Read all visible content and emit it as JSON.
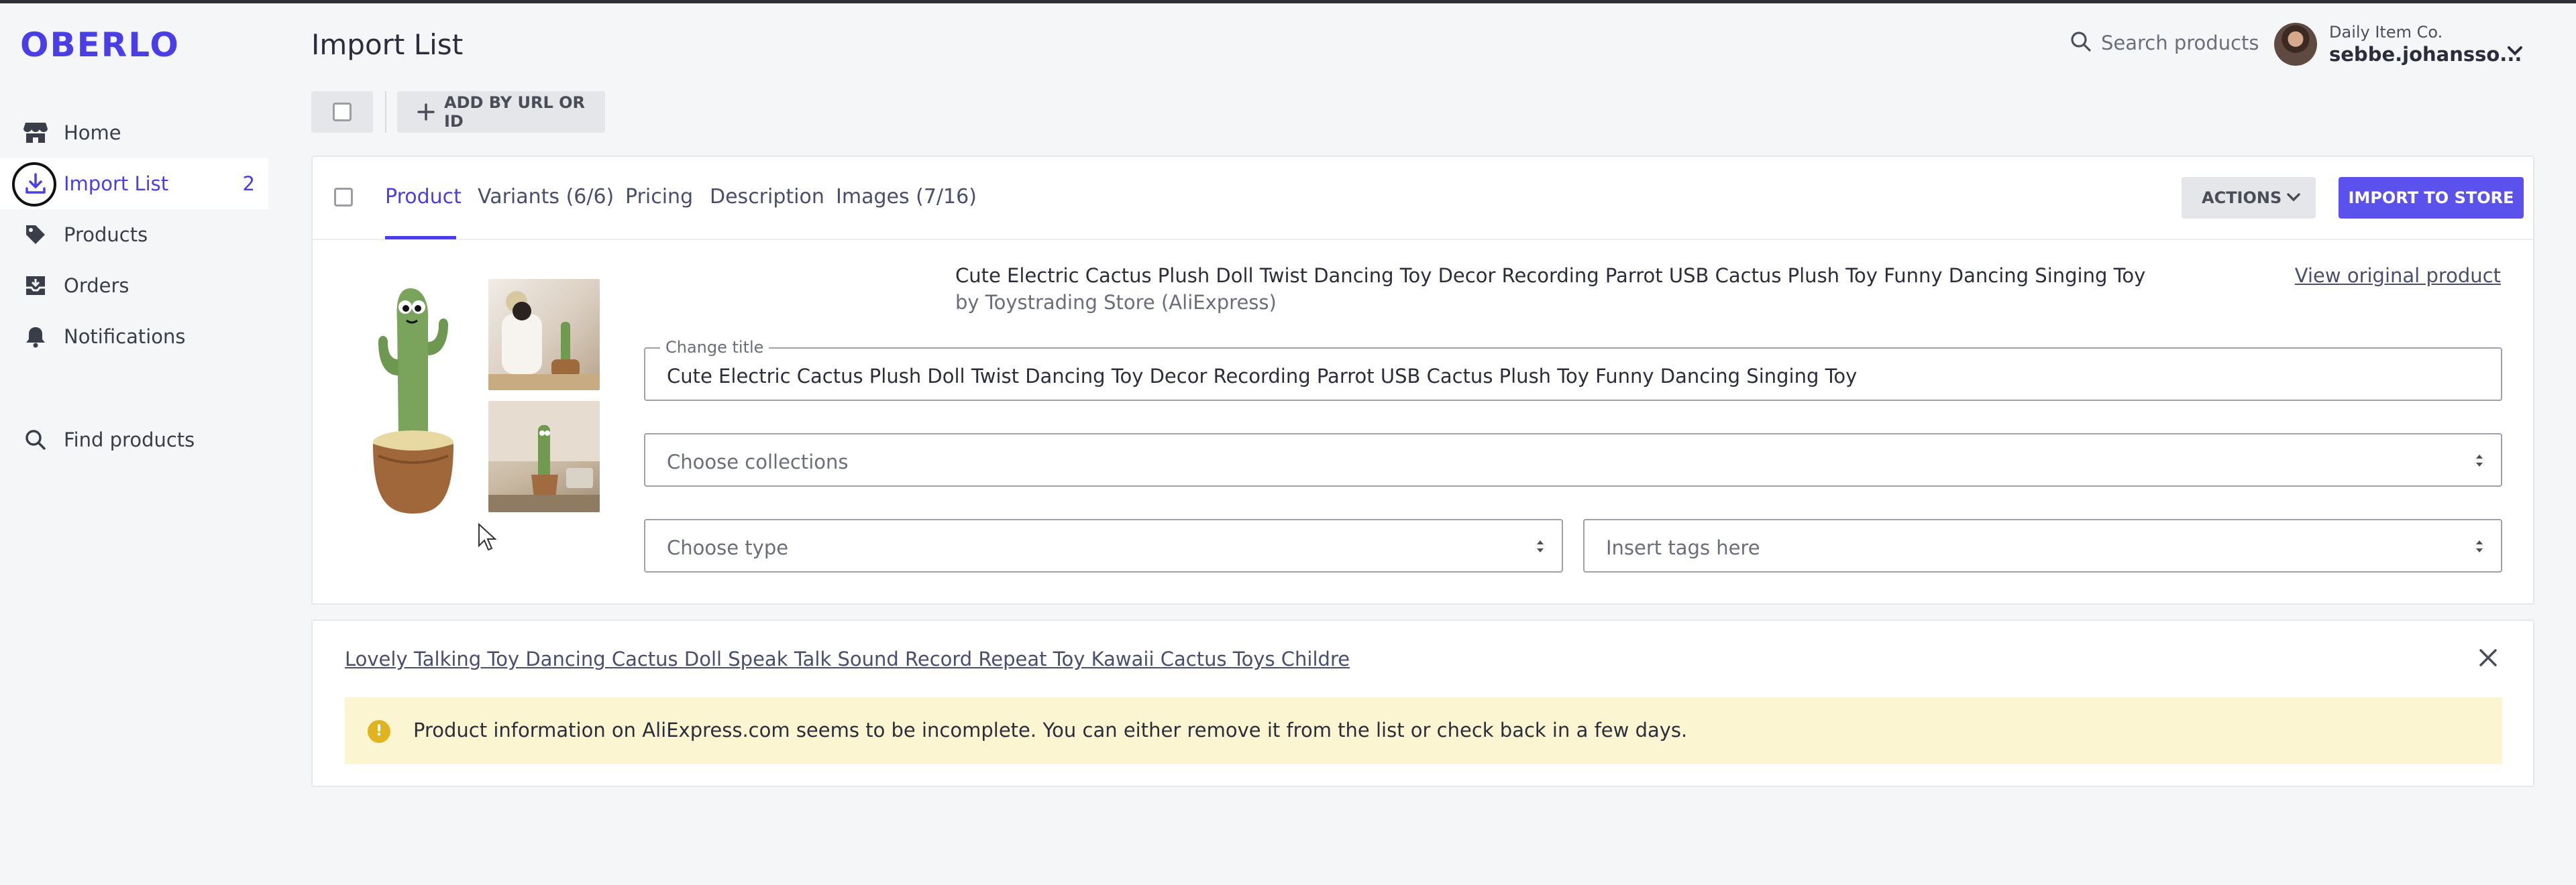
{
  "app": {
    "logo": "OBERLO",
    "accent": "#4a3fe6",
    "primary_button": "#5b52ee"
  },
  "sidebar": {
    "items": [
      {
        "label": "Home",
        "icon": "store-icon"
      },
      {
        "label": "Import List",
        "icon": "download-icon",
        "count": "2",
        "active": true
      },
      {
        "label": "Products",
        "icon": "tag-icon"
      },
      {
        "label": "Orders",
        "icon": "inbox-icon"
      },
      {
        "label": "Notifications",
        "icon": "bell-icon"
      },
      {
        "label": "Find products",
        "icon": "search-icon"
      }
    ]
  },
  "header": {
    "title": "Import List",
    "search_label": "Search products",
    "account": {
      "store": "Daily Item Co.",
      "user": "sebbe.johansso..."
    }
  },
  "toolbar": {
    "add_label": "ADD BY URL OR ID"
  },
  "product": {
    "tabs": [
      {
        "label": "Product",
        "active": true
      },
      {
        "label": "Variants (6/6)"
      },
      {
        "label": "Pricing"
      },
      {
        "label": "Description"
      },
      {
        "label": "Images (7/16)"
      }
    ],
    "actions_label": "ACTIONS",
    "import_label": "IMPORT TO STORE",
    "title": "Cute Electric Cactus Plush Doll Twist Dancing Toy Decor Recording Parrot USB Cactus Plush Toy Funny Dancing Singing Toy",
    "by": "by Toystrading Store (AliExpress)",
    "view_original": "View original product",
    "change_title_legend": "Change title",
    "change_title_value": "Cute Electric Cactus Plush Doll Twist Dancing Toy Decor Recording Parrot USB Cactus Plush Toy Funny Dancing Singing Toy",
    "collections_placeholder": "Choose collections",
    "type_placeholder": "Choose type",
    "tags_placeholder": "Insert tags here"
  },
  "incomplete_product": {
    "title": "Lovely Talking Toy Dancing Cactus Doll Speak Talk Sound Record Repeat Toy Kawaii Cactus Toys Childre",
    "warning_icon": "!",
    "warning": "Product information on AliExpress.com seems to be incomplete. You can either remove it from the list or check back in a few days."
  }
}
